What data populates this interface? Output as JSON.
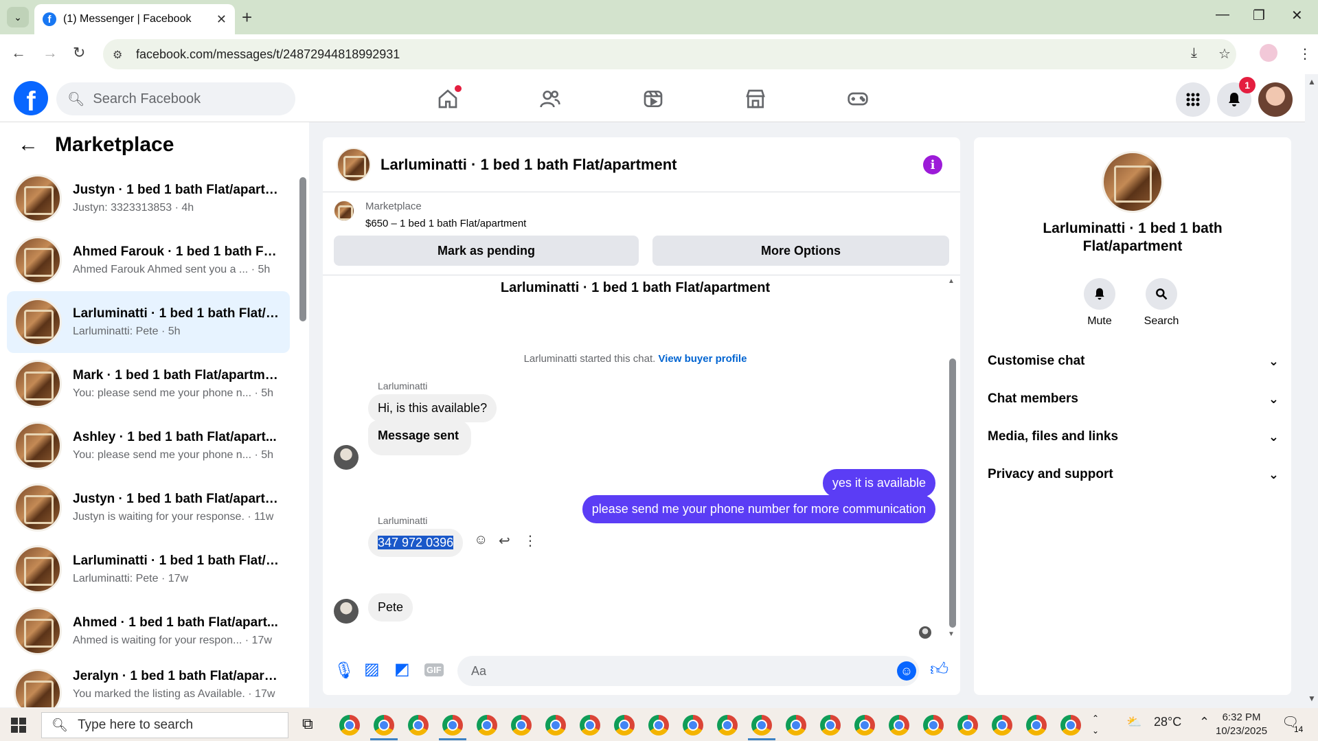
{
  "browser": {
    "tab_title": "(1) Messenger | Facebook",
    "tab_close": "✕",
    "new_tab": "+",
    "url": "facebook.com/messages/t/24872944818992931"
  },
  "fb": {
    "search_placeholder": "Search Facebook",
    "notification_count": "1"
  },
  "sidebar": {
    "title": "Marketplace",
    "conversations": [
      {
        "name": "Justyn · 1 bed 1 bath Flat/apartm...",
        "preview": "Justyn: 3323313853 · 4h"
      },
      {
        "name": "Ahmed Farouk · 1 bed 1 bath Fla...",
        "preview": "Ahmed Farouk Ahmed sent you a ... · 5h"
      },
      {
        "name": "Larluminatti · 1 bed 1 bath Flat/a...",
        "preview": "Larluminatti: Pete · 5h"
      },
      {
        "name": "Mark · 1 bed 1 bath Flat/apartme...",
        "preview": "You: please send me your phone n... · 5h"
      },
      {
        "name": "Ashley · 1 bed 1 bath Flat/apart...",
        "preview": "You: please send me your phone n... · 5h"
      },
      {
        "name": "Justyn · 1 bed 1 bath Flat/apartm...",
        "preview": "Justyn is waiting for your response. · 11w"
      },
      {
        "name": "Larluminatti · 1 bed 1 bath Flat/a...",
        "preview": "Larluminatti: Pete · 17w"
      },
      {
        "name": "Ahmed · 1 bed 1 bath Flat/apart...",
        "preview": "Ahmed is waiting for your respon... · 17w"
      },
      {
        "name": "Jeralyn · 1 bed 1 bath Flat/apart...",
        "preview": "You marked the listing as Available. · 17w"
      }
    ]
  },
  "chat": {
    "header_title": "Larluminatti · 1 bed 1 bath Flat/apartment",
    "listing_source": "Marketplace",
    "listing_title": "$650 – 1 bed 1 bath Flat/apartment",
    "btn_pending": "Mark as pending",
    "btn_more": "More Options",
    "conv_title": "Larluminatti · 1 bed 1 bath Flat/apartment",
    "started_text": "Larluminatti started this chat.",
    "view_buyer": "View buyer profile",
    "sender_name": "Larluminatti",
    "messages": {
      "in1": "Hi, is this available?",
      "in2": "Message sent",
      "out1": "yes it is available",
      "out2": "please send me your phone number for more communication",
      "in3": "347 972 0396",
      "in4": "Pete"
    },
    "composer_placeholder": "Aa"
  },
  "details": {
    "name": "Larluminatti · 1 bed 1 bath Flat/apartment",
    "mute": "Mute",
    "search": "Search",
    "sections": [
      "Customise chat",
      "Chat members",
      "Media, files and links",
      "Privacy and support"
    ]
  },
  "taskbar": {
    "search_placeholder": "Type here to search",
    "weather": "28°C",
    "time": "6:32 PM",
    "date": "10/23/2025",
    "notif_count": "14"
  },
  "colors": {
    "fb_blue": "#0866ff",
    "outgoing_bubble": "#5b3df5",
    "info_purple": "#9c1bd8"
  }
}
